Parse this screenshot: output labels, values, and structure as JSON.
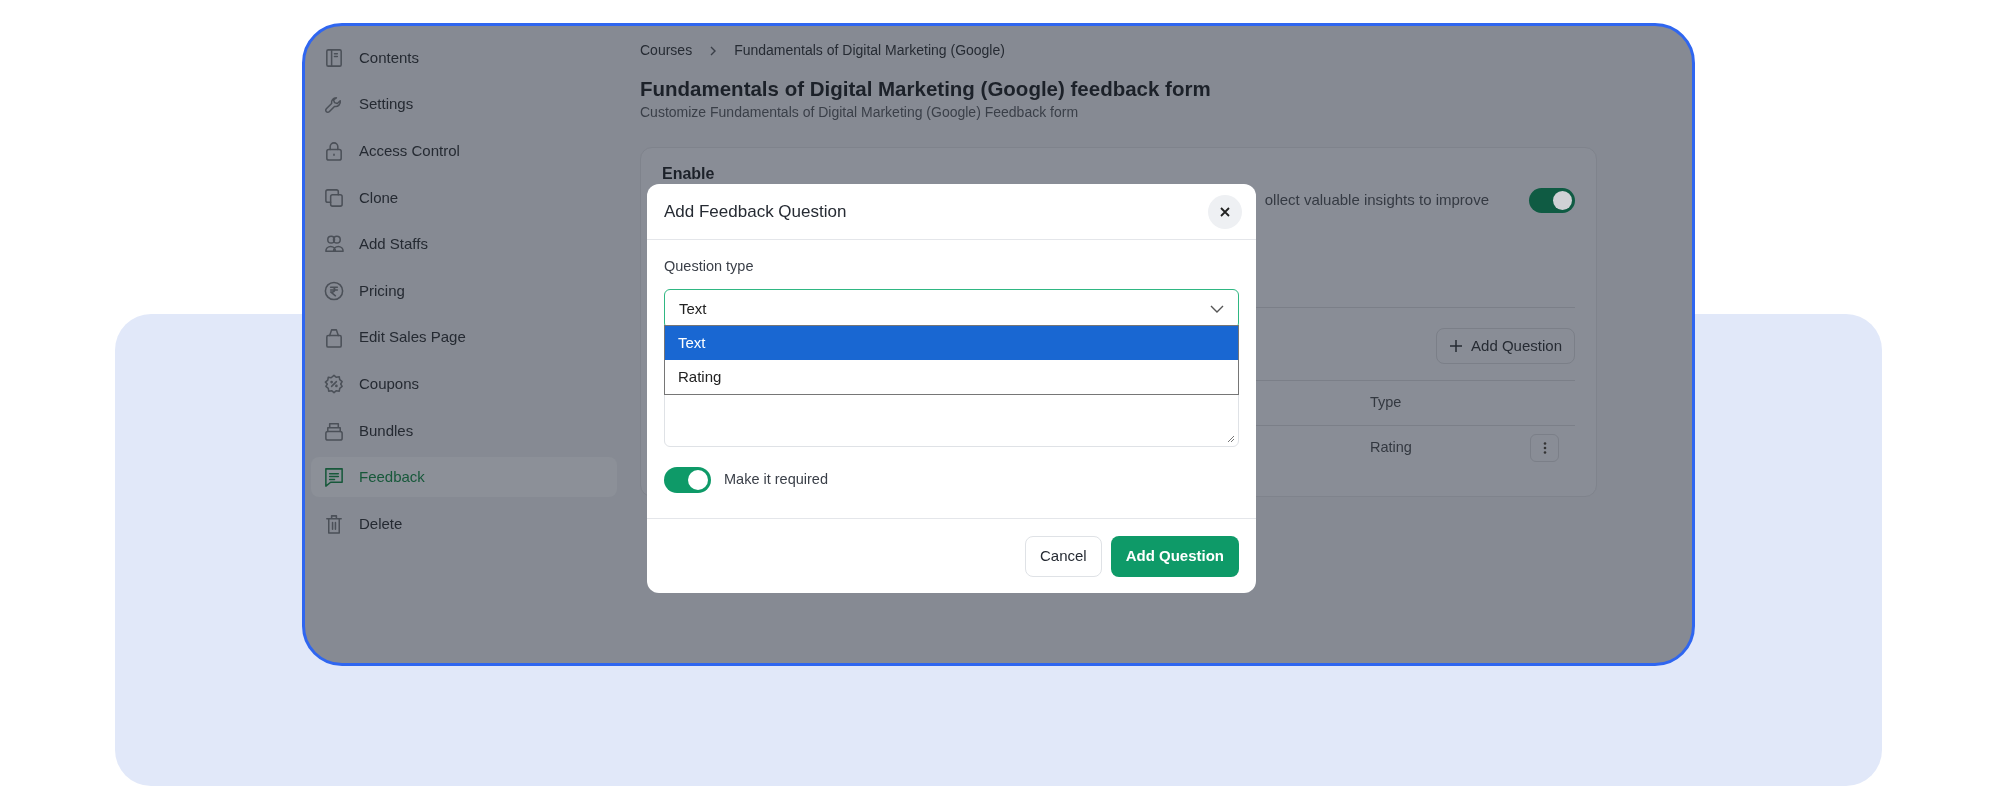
{
  "sidebar": {
    "items": [
      {
        "label": "Contents",
        "selected": false
      },
      {
        "label": "Settings",
        "selected": false
      },
      {
        "label": "Access Control",
        "selected": false
      },
      {
        "label": "Clone",
        "selected": false
      },
      {
        "label": "Add Staffs",
        "selected": false
      },
      {
        "label": "Pricing",
        "selected": false
      },
      {
        "label": "Edit Sales Page",
        "selected": false
      },
      {
        "label": "Coupons",
        "selected": false
      },
      {
        "label": "Bundles",
        "selected": false
      },
      {
        "label": "Feedback",
        "selected": true
      },
      {
        "label": "Delete",
        "selected": false
      }
    ]
  },
  "breadcrumb": [
    "Courses",
    "Fundamentals of Digital Marketing (Google)"
  ],
  "page": {
    "title": "Fundamentals of Digital Marketing (Google) feedback form",
    "subtitle": "Customize Fundamentals of Digital Marketing (Google) Feedback form"
  },
  "settings_card": {
    "enable_label": "Enable",
    "enable_description": "ollect valuable insights to improve",
    "enabled": true,
    "add_question_button": "Add Question",
    "table": {
      "columns": [
        "Type"
      ],
      "rows": [
        {
          "type": "Rating"
        }
      ]
    }
  },
  "modal": {
    "title": "Add Feedback Question",
    "question_type_label": "Question type",
    "question_type_value": "Text",
    "dropdown_options": [
      {
        "label": "Text",
        "selected": true
      },
      {
        "label": "Rating",
        "selected": false
      }
    ],
    "required": {
      "label": "Make it required",
      "on": true
    },
    "cancel_button": "Cancel",
    "submit_button": "Add Question"
  }
}
